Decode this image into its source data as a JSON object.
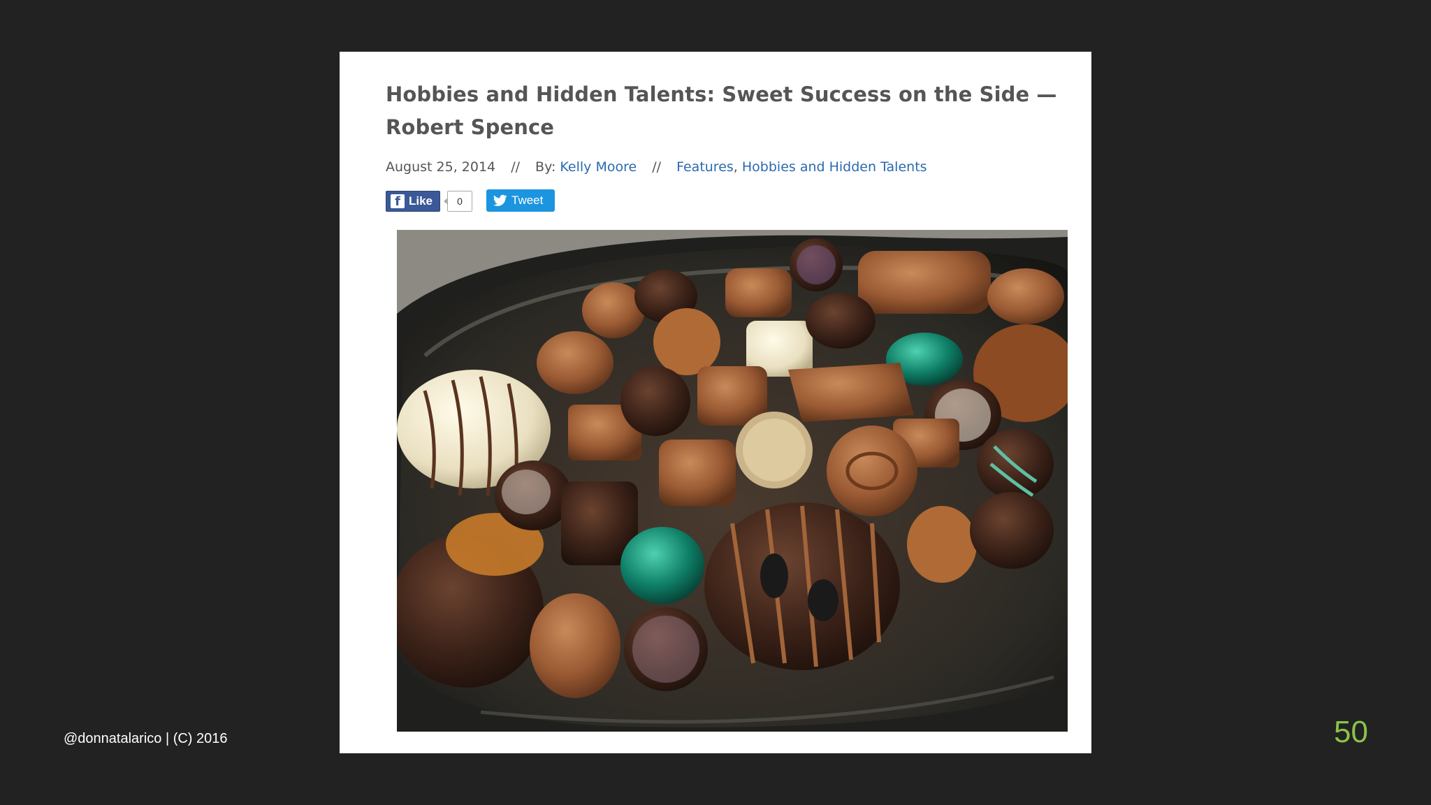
{
  "article": {
    "title": "Hobbies and Hidden Talents: Sweet Success on the Side — Robert Spence",
    "date": "August 25, 2014",
    "separator": "//",
    "by_label": "By:",
    "author": "Kelly Moore",
    "category_1": "Features",
    "category_sep": ",",
    "category_2": "Hobbies and Hidden Talents"
  },
  "social": {
    "like_label": "Like",
    "like_count": "0",
    "tweet_label": "Tweet",
    "facebook_icon": "facebook-icon",
    "twitter_icon": "twitter-bird-icon"
  },
  "photo": {
    "subject": "tray of assorted chocolates"
  },
  "slide": {
    "credit": "@donnatalarico | (C) 2016",
    "number": "50"
  },
  "colors": {
    "background": "#222222",
    "link": "#2a6ab0",
    "facebook": "#3b5998",
    "twitter": "#1b95e0",
    "slide_number": "#8bc34a"
  }
}
